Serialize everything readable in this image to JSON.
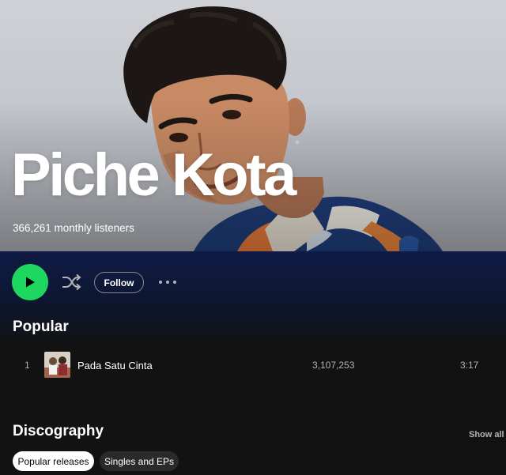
{
  "artist": {
    "name": "Piche Kota",
    "monthly_listeners": "366,261 monthly listeners"
  },
  "actions": {
    "play_icon": "play-icon",
    "shuffle_icon": "shuffle-icon",
    "follow_label": "Follow",
    "more_icon": "more-options-icon"
  },
  "popular": {
    "title": "Popular",
    "tracks": [
      {
        "number": "1",
        "title": "Pada Satu Cinta",
        "plays": "3,107,253",
        "duration": "3:17"
      }
    ]
  },
  "discography": {
    "title": "Discography",
    "show_all": "Show all",
    "filters": [
      {
        "label": "Popular releases",
        "active": true
      },
      {
        "label": "Singles and EPs",
        "active": false
      }
    ]
  },
  "colors": {
    "accent_green": "#1ed760",
    "background": "#121212",
    "header_gradient_top": "#0f1b45"
  }
}
